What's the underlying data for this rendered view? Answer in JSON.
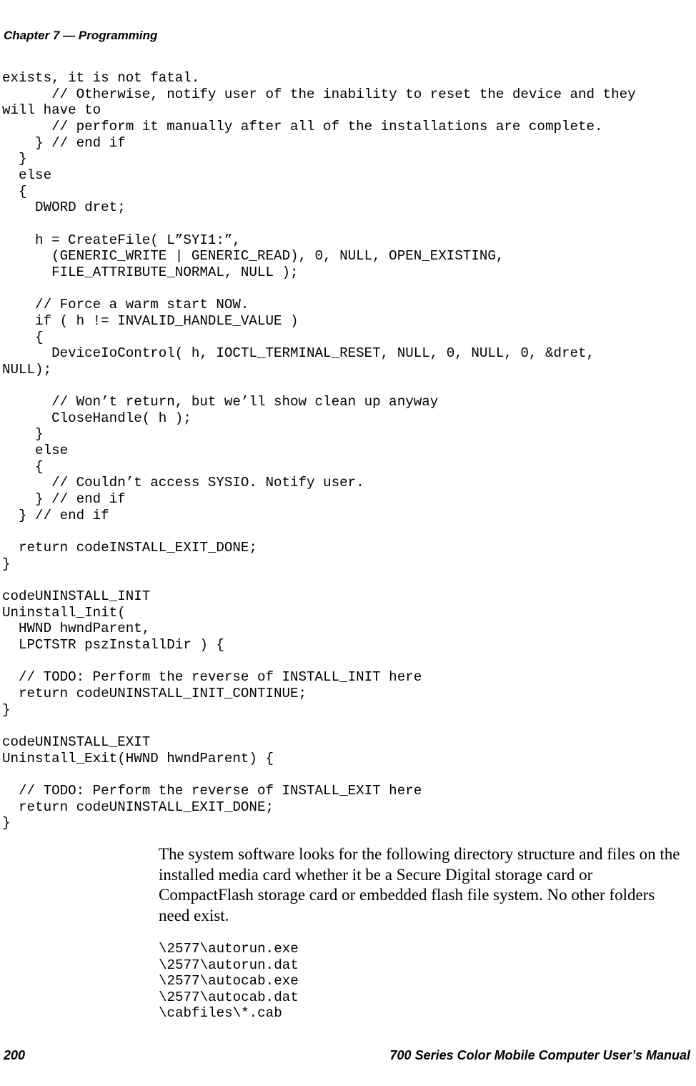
{
  "header": {
    "chapter_label": "Chapter 7",
    "separator": "  —  ",
    "chapter_title": "Programming"
  },
  "code": "exists, it is not fatal.\n      // Otherwise, notify user of the inability to reset the device and they\nwill have to\n      // perform it manually after all of the installations are complete.\n    } // end if\n  }\n  else\n  {\n    DWORD dret;\n\n    h = CreateFile( L”SYI1:”,\n      (GENERIC_WRITE | GENERIC_READ), 0, NULL, OPEN_EXISTING,\n      FILE_ATTRIBUTE_NORMAL, NULL );\n\n    // Force a warm start NOW.\n    if ( h != INVALID_HANDLE_VALUE )\n    {\n      DeviceIoControl( h, IOCTL_TERMINAL_RESET, NULL, 0, NULL, 0, &dret,\nNULL);\n\n      // Won’t return, but we’ll show clean up anyway\n      CloseHandle( h );\n    }\n    else\n    {\n      // Couldn’t access SYSIO. Notify user.\n    } // end if\n  } // end if\n\n  return codeINSTALL_EXIT_DONE;\n}\n\ncodeUNINSTALL_INIT\nUninstall_Init(\n  HWND hwndParent,\n  LPCTSTR pszInstallDir ) {\n\n  // TODO: Perform the reverse of INSTALL_INIT here\n  return codeUNINSTALL_INIT_CONTINUE;\n}\n\ncodeUNINSTALL_EXIT\nUninstall_Exit(HWND hwndParent) {\n\n  // TODO: Perform the reverse of INSTALL_EXIT here\n  return codeUNINSTALL_EXIT_DONE;\n}",
  "body_paragraph": "The system software looks for the following directory structure and files on the installed media card whether it be a Secure Digital storage card or CompactFlash storage card or embedded flash file system. No other folders need exist.",
  "file_list": "\\2577\\autorun.exe\n\\2577\\autorun.dat\n\\2577\\autocab.exe\n\\2577\\autocab.dat\n\\cabfiles\\*.cab",
  "footer": {
    "page_number": "200",
    "manual_title": "700 Series Color Mobile Computer User’s Manual"
  }
}
